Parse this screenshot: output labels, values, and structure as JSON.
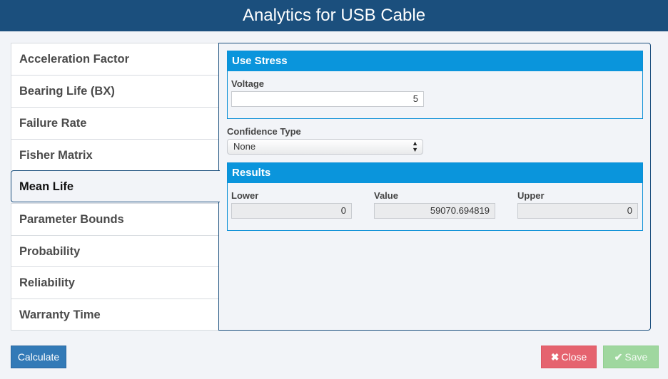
{
  "header": {
    "title": "Analytics for USB Cable"
  },
  "sidebar": {
    "items": [
      {
        "label": "Acceleration Factor",
        "active": false
      },
      {
        "label": "Bearing Life (BX)",
        "active": false
      },
      {
        "label": "Failure Rate",
        "active": false
      },
      {
        "label": "Fisher Matrix",
        "active": false
      },
      {
        "label": "Mean Life",
        "active": true
      },
      {
        "label": "Parameter Bounds",
        "active": false
      },
      {
        "label": "Probability",
        "active": false
      },
      {
        "label": "Reliability",
        "active": false
      },
      {
        "label": "Warranty Time",
        "active": false
      }
    ]
  },
  "use_stress": {
    "title": "Use Stress",
    "voltage_label": "Voltage",
    "voltage_value": "5"
  },
  "confidence": {
    "label": "Confidence Type",
    "selected": "None"
  },
  "results": {
    "title": "Results",
    "lower_label": "Lower",
    "lower_value": "0",
    "value_label": "Value",
    "value_value": "59070.694819",
    "upper_label": "Upper",
    "upper_value": "0"
  },
  "footer": {
    "calculate_label": "Calculate",
    "close_label": "Close",
    "close_icon": "✖",
    "save_label": "Save",
    "save_icon": "✔"
  },
  "colors": {
    "header": "#1b4f7d",
    "section_header": "#0a95dc",
    "calculate": "#337ab7",
    "close": "#e5636f",
    "save": "#9fd79f"
  }
}
